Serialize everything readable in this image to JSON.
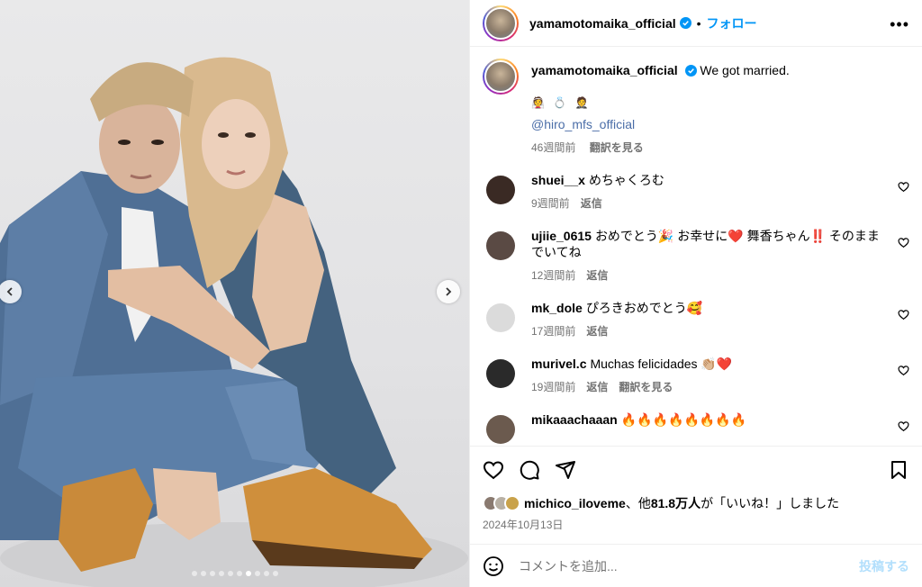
{
  "post": {
    "username": "yamamotomaika_official",
    "separator": "•",
    "follow_label": "フォロー",
    "more_label": "•••",
    "caption_text": "We got married.",
    "caption_emojis": "👰 💍 🤵",
    "caption_mention": "@hiro_mfs_official",
    "caption_time": "46週間前",
    "caption_translate": "翻訳を見る"
  },
  "carousel": {
    "total": 10,
    "active_index": 6
  },
  "comments": [
    {
      "username": "shuei__x",
      "text": "めちゃくろむ",
      "time": "9週間前",
      "reply": "返信",
      "translate": "",
      "avatar_color": "#3a2a24"
    },
    {
      "username": "ujiie_0615",
      "text": "おめでとう🎉 お幸せに❤️ 舞香ちゃん‼️ そのままでいてね",
      "time": "12週間前",
      "reply": "返信",
      "translate": "",
      "avatar_color": "#5a4a44"
    },
    {
      "username": "mk_dole",
      "text": "ぴろきおめでとう🥰",
      "time": "17週間前",
      "reply": "返信",
      "translate": "",
      "avatar_color": "#dbdbdb"
    },
    {
      "username": "murivel.c",
      "text": "Muchas felicidades 👏🏼❤️",
      "time": "19週間前",
      "reply": "返信",
      "translate": "翻訳を見る",
      "avatar_color": "#2a2a2a"
    },
    {
      "username": "mikaaachaaan",
      "text": "🔥🔥🔥🔥🔥🔥🔥🔥",
      "time": "",
      "reply": "",
      "translate": "",
      "avatar_color": "#6b5a4e"
    }
  ],
  "likes": {
    "liker": "michico_iloveme",
    "rest_prefix": "、他",
    "count": "81.8万人",
    "suffix": "が「いいね！」しました"
  },
  "date": "2024年10月13日",
  "add_comment": {
    "placeholder": "コメントを追加...",
    "post_label": "投稿する"
  },
  "colors": {
    "accent": "#0095f6",
    "verified": "#0095f6",
    "heart_red": "#ff3040"
  },
  "icons": [
    "like-icon",
    "comment-icon",
    "share-icon",
    "bookmark-icon",
    "emoji-icon",
    "heart-icon",
    "verified-icon",
    "more-icon"
  ]
}
